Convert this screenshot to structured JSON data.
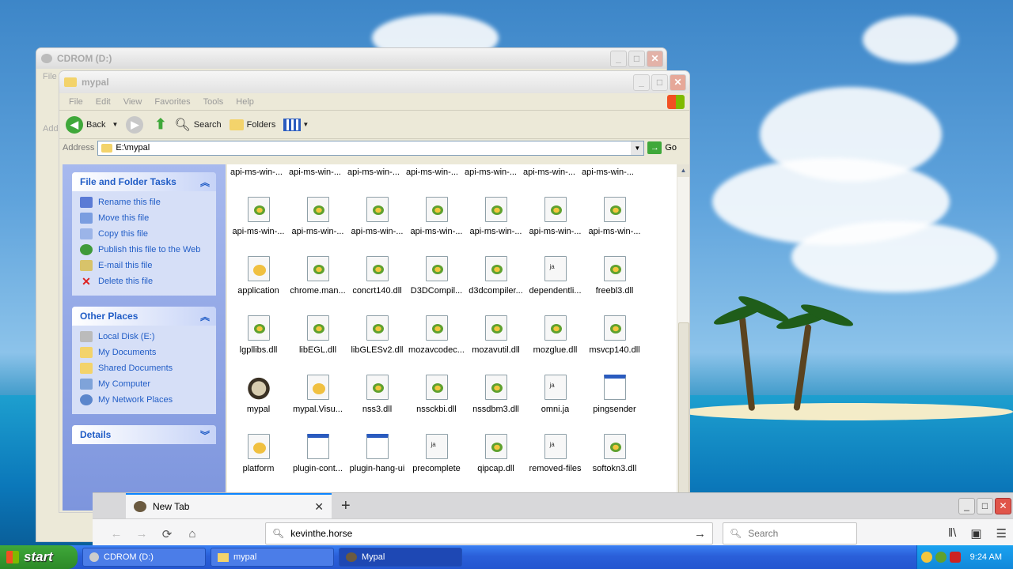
{
  "desktop": {},
  "cdrom_window": {
    "title": "CDROM (D:)",
    "peek_menu": "File",
    "peek_add": "Add"
  },
  "mypal_window": {
    "title": "mypal",
    "menu": [
      "File",
      "Edit",
      "View",
      "Favorites",
      "Tools",
      "Help"
    ],
    "toolbar": {
      "back": "Back",
      "search": "Search",
      "folders": "Folders"
    },
    "address_label": "Address",
    "address_value": "E:\\mypal",
    "go_label": "Go"
  },
  "file_tasks": {
    "title": "File and Folder Tasks",
    "items": [
      "Rename this file",
      "Move this file",
      "Copy this file",
      "Publish this file to the Web",
      "E-mail this file",
      "Delete this file"
    ]
  },
  "other_places": {
    "title": "Other Places",
    "items": [
      "Local Disk (E:)",
      "My Documents",
      "Shared Documents",
      "My Computer",
      "My Network Places"
    ]
  },
  "details": {
    "title": "Details"
  },
  "files": {
    "top_partial": [
      "api-ms-win-...",
      "api-ms-win-...",
      "api-ms-win-...",
      "api-ms-win-...",
      "api-ms-win-...",
      "api-ms-win-...",
      "api-ms-win-..."
    ],
    "rows": [
      [
        {
          "name": "api-ms-win-...",
          "type": "dll"
        },
        {
          "name": "api-ms-win-...",
          "type": "dll"
        },
        {
          "name": "api-ms-win-...",
          "type": "dll"
        },
        {
          "name": "api-ms-win-...",
          "type": "dll"
        },
        {
          "name": "api-ms-win-...",
          "type": "dll"
        },
        {
          "name": "api-ms-win-...",
          "type": "dll"
        },
        {
          "name": "api-ms-win-...",
          "type": "dll"
        }
      ],
      [
        {
          "name": "application",
          "type": "cfg"
        },
        {
          "name": "chrome.man...",
          "type": "dll"
        },
        {
          "name": "concrt140.dll",
          "type": "dll"
        },
        {
          "name": "D3DCompil...",
          "type": "dll"
        },
        {
          "name": "d3dcompiler...",
          "type": "dll"
        },
        {
          "name": "dependentli...",
          "type": "ja"
        },
        {
          "name": "freebl3.dll",
          "type": "dll"
        }
      ],
      [
        {
          "name": "lgpllibs.dll",
          "type": "dll"
        },
        {
          "name": "libEGL.dll",
          "type": "dll"
        },
        {
          "name": "libGLESv2.dll",
          "type": "dll"
        },
        {
          "name": "mozavcodec...",
          "type": "dll"
        },
        {
          "name": "mozavutil.dll",
          "type": "dll"
        },
        {
          "name": "mozglue.dll",
          "type": "dll"
        },
        {
          "name": "msvcp140.dll",
          "type": "dll"
        }
      ],
      [
        {
          "name": "mypal",
          "type": "raccoon"
        },
        {
          "name": "mypal.Visu...",
          "type": "cfg"
        },
        {
          "name": "nss3.dll",
          "type": "dll"
        },
        {
          "name": "nssckbi.dll",
          "type": "dll"
        },
        {
          "name": "nssdbm3.dll",
          "type": "dll"
        },
        {
          "name": "omni.ja",
          "type": "ja"
        },
        {
          "name": "pingsender",
          "type": "app"
        }
      ],
      [
        {
          "name": "platform",
          "type": "cfg"
        },
        {
          "name": "plugin-cont...",
          "type": "app"
        },
        {
          "name": "plugin-hang-ui",
          "type": "app"
        },
        {
          "name": "precomplete",
          "type": "ja"
        },
        {
          "name": "qipcap.dll",
          "type": "dll"
        },
        {
          "name": "removed-files",
          "type": "ja"
        },
        {
          "name": "softokn3.dll",
          "type": "dll"
        }
      ]
    ]
  },
  "browser": {
    "tab_title": "New Tab",
    "url_value": "kevinthe.horse",
    "search_placeholder": "Search"
  },
  "taskbar": {
    "start_label": "start",
    "tasks": [
      "CDROM (D:)",
      "mypal",
      "Mypal"
    ],
    "clock": "9:24 AM"
  }
}
